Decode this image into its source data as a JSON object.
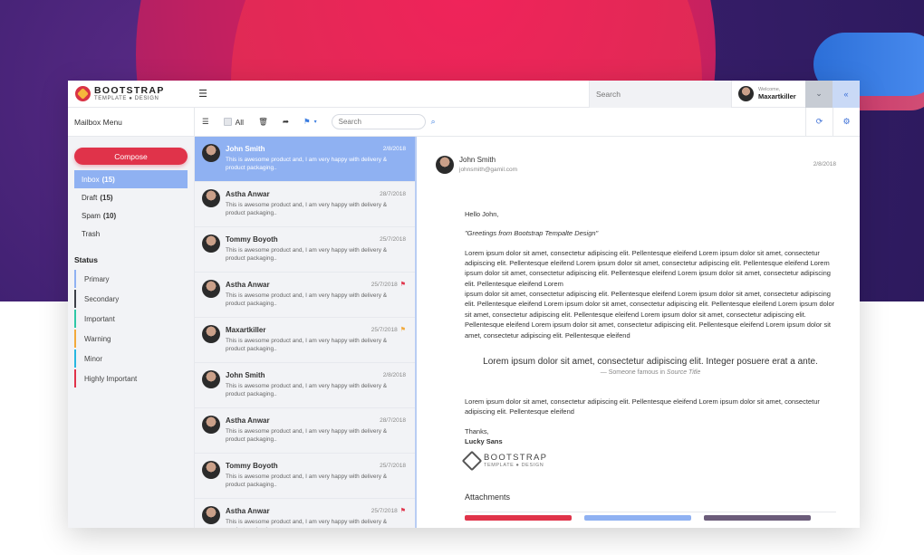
{
  "brand": {
    "line1": "BOOTSTRAP",
    "line2": "TEMPLATE ● DESIGN"
  },
  "top_search": {
    "placeholder": "Search"
  },
  "user": {
    "welcome": "Welcome,",
    "name": "Maxartkiller"
  },
  "sidebar": {
    "title": "Mailbox Menu",
    "compose_label": "Compose",
    "folders": [
      {
        "label": "Inbox",
        "count": "(15)"
      },
      {
        "label": "Draft",
        "count": "(15)"
      },
      {
        "label": "Spam",
        "count": "(10)"
      },
      {
        "label": "Trash",
        "count": ""
      }
    ],
    "status_title": "Status",
    "statuses": [
      {
        "label": "Primary",
        "color": "#8fb1f2"
      },
      {
        "label": "Secondary",
        "color": "#3c4048"
      },
      {
        "label": "Important",
        "color": "#2ec7a6"
      },
      {
        "label": "Warning",
        "color": "#f2a93b"
      },
      {
        "label": "Minor",
        "color": "#27b7e0"
      },
      {
        "label": "Highly Important",
        "color": "#e0334a"
      }
    ]
  },
  "toolbar": {
    "all_label": "All",
    "search_placeholder": "Search"
  },
  "messages": [
    {
      "sender": "John Smith",
      "date": "2/8/2018",
      "preview": "This is awesome product and, I am very happy with delivery & product packaging..",
      "flag": ""
    },
    {
      "sender": "Astha Anwar",
      "date": "28/7/2018",
      "preview": "This is awesome product and, I am very happy with delivery & product packaging..",
      "flag": ""
    },
    {
      "sender": "Tommy Boyoth",
      "date": "25/7/2018",
      "preview": "This is awesome product and, I am very happy with delivery & product packaging..",
      "flag": ""
    },
    {
      "sender": "Astha Anwar",
      "date": "25/7/2018",
      "preview": "This is awesome product and, I am very happy with delivery & product packaging..",
      "flag": "#e0334a"
    },
    {
      "sender": "Maxartkiller",
      "date": "25/7/2018",
      "preview": "This is awesome product and, I am very happy with delivery & product packaging..",
      "flag": "#f2a93b"
    },
    {
      "sender": "John Smith",
      "date": "2/8/2018",
      "preview": "This is awesome product and, I am very happy with delivery & product packaging..",
      "flag": ""
    },
    {
      "sender": "Astha Anwar",
      "date": "28/7/2018",
      "preview": "This is awesome product and, I am very happy with delivery & product packaging..",
      "flag": ""
    },
    {
      "sender": "Tommy Boyoth",
      "date": "25/7/2018",
      "preview": "This is awesome product and, I am very happy with delivery & product packaging..",
      "flag": ""
    },
    {
      "sender": "Astha Anwar",
      "date": "25/7/2018",
      "preview": "This is awesome product and, I am very happy with delivery & product packaging..",
      "flag": "#e0334a"
    }
  ],
  "reader": {
    "from_name": "John Smith",
    "from_email": "johnsmith@gamil.com",
    "date": "2/8/2018",
    "greeting": "Hello John,",
    "greeting_quote": "\"Greetings from Bootstrap Tempalte Design\"",
    "para1": "Lorem ipsum dolor sit amet, consectetur adipiscing elit. Pellentesque eleifend Lorem ipsum dolor sit amet, consectetur adipiscing elit. Pellentesque eleifend Lorem ipsum dolor sit amet, consectetur adipiscing elit. Pellentesque eleifend Lorem ipsum dolor sit amet, consectetur adipiscing elit. Pellentesque eleifend Lorem ipsum dolor sit amet, consectetur adipiscing elit. Pellentesque eleifend Lorem",
    "para2": "ipsum dolor sit amet, consectetur adipiscing elit. Pellentesque eleifend Lorem ipsum dolor sit amet, consectetur adipiscing elit. Pellentesque eleifend Lorem ipsum dolor sit amet, consectetur adipiscing elit. Pellentesque eleifend Lorem ipsum dolor sit amet, consectetur adipiscing elit. Pellentesque eleifend Lorem ipsum dolor sit amet, consectetur adipiscing elit. Pellentesque eleifend Lorem ipsum dolor sit amet, consectetur adipiscing elit. Pellentesque eleifend Lorem ipsum dolor sit amet, consectetur adipiscing elit. Pellentesque eleifend",
    "quote": "Lorem ipsum dolor sit amet, consectetur adipiscing elit. Integer posuere erat a ante.",
    "quote_source_prefix": "— Someone famous in",
    "quote_source_title": "Source Title",
    "para3": "Lorem ipsum dolor sit amet, consectetur adipiscing elit. Pellentesque eleifend Lorem ipsum dolor sit amet, consectetur adipiscing elit. Pellentesque eleifend",
    "thanks": "Thanks,",
    "signature": "Lucky Sans",
    "attachments_title": "Attachments",
    "attachment_colors": [
      "#e0334a",
      "#8fb1f2",
      "#6b5c7a"
    ]
  },
  "colors": {
    "accent": "#e0334a",
    "active_blue": "#8fb1f2",
    "link_blue": "#3b6fd6"
  }
}
